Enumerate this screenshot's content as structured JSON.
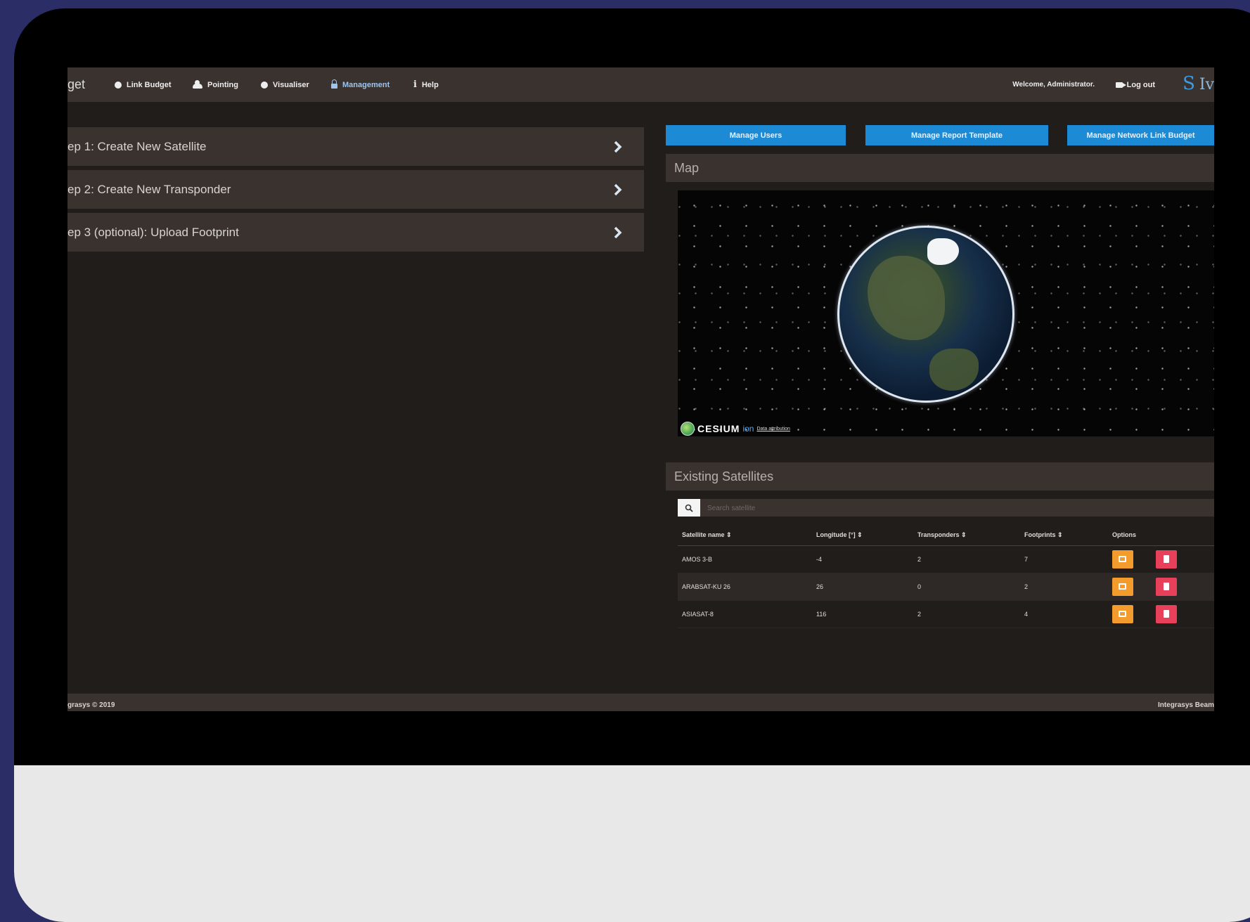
{
  "nav": {
    "brand": "get",
    "items": [
      {
        "label": "Link Budget",
        "icon": "globe-icon"
      },
      {
        "label": "Pointing",
        "icon": "cloud-icon"
      },
      {
        "label": "Visualiser",
        "icon": "globe-icon"
      },
      {
        "label": "Management",
        "icon": "lock-icon",
        "active": true
      },
      {
        "label": "Help",
        "icon": "info-icon"
      }
    ],
    "welcome": "Welcome, Administrator.",
    "logout": "Log out",
    "logo": "S",
    "logo_rest": "Iv"
  },
  "steps": [
    {
      "label": "ep 1: Create New Satellite"
    },
    {
      "label": "ep 2: Create New Transponder"
    },
    {
      "label": "ep 3 (optional): Upload Footprint"
    }
  ],
  "buttons": {
    "manage_users": "Manage Users",
    "manage_report": "Manage Report Template",
    "manage_network": "Manage Network Link Budget"
  },
  "map": {
    "title": "Map",
    "cesium": "CESIUM",
    "ion": "ion",
    "attribution": "Data attribution"
  },
  "satellites": {
    "title": "Existing Satellites",
    "search_placeholder": "Search satellite",
    "columns": [
      "Satellite name ⇕",
      "Longitude [°] ⇕",
      "Transponders ⇕",
      "Footprints ⇕",
      "Options"
    ],
    "rows": [
      [
        "AMOS 3-B",
        "-4",
        "2",
        "7"
      ],
      [
        "ARABSAT-KU 26",
        "26",
        "0",
        "2"
      ],
      [
        "ASIASAT-8",
        "116",
        "2",
        "4"
      ]
    ]
  },
  "footer": {
    "left": "grasys © 2019",
    "right": "Integrasys Beam"
  },
  "colors": {
    "accent": "#1d8ad6",
    "edit": "#f39b2c",
    "delete": "#e8405a",
    "panel": "#3a322f"
  }
}
